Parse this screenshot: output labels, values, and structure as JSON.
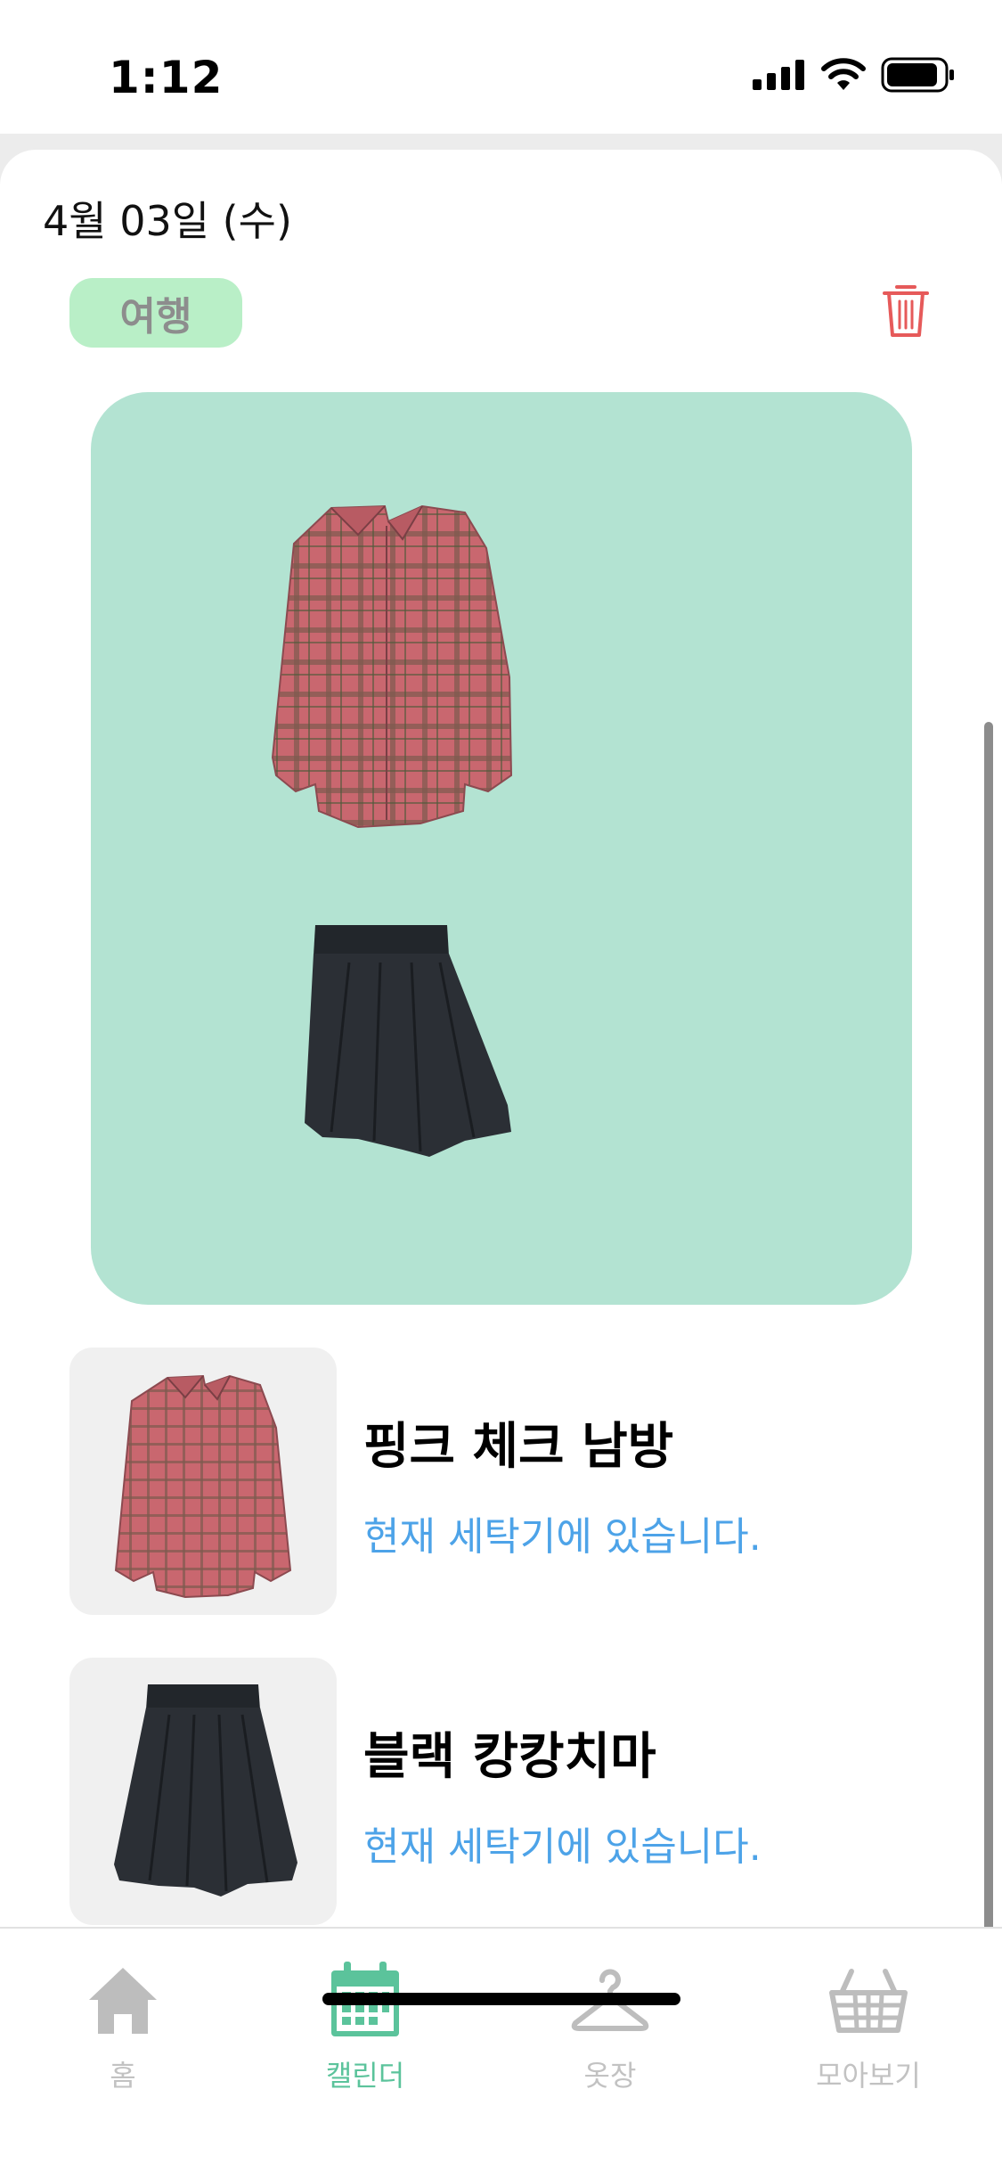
{
  "status_bar": {
    "time": "1:12",
    "icons": [
      "signal-icon",
      "wifi-icon",
      "battery-icon"
    ]
  },
  "header": {
    "date": "4월 03일 (수)",
    "tag": "여행",
    "delete_icon": "trash-icon"
  },
  "outfit": {
    "background_color": "#b3e3d2",
    "items_shown": [
      "pink plaid shirt",
      "black pleated skirt"
    ]
  },
  "items": [
    {
      "name": "핑크 체크 남방",
      "status": "현재 세탁기에 있습니다."
    },
    {
      "name": "블랙 캉캉치마",
      "status": "현재 세탁기에 있습니다."
    }
  ],
  "tab_bar": {
    "tabs": [
      {
        "label": "홈",
        "icon": "home-icon",
        "active": false
      },
      {
        "label": "캘린더",
        "icon": "calendar-icon",
        "active": true
      },
      {
        "label": "옷장",
        "icon": "hanger-icon",
        "active": false
      },
      {
        "label": "모아보기",
        "icon": "basket-icon",
        "active": false
      }
    ]
  },
  "colors": {
    "accent": "#5bc39b",
    "tag_background": "#b9efc7",
    "status_text": "#4da3e8",
    "delete": "#e65a5a"
  }
}
